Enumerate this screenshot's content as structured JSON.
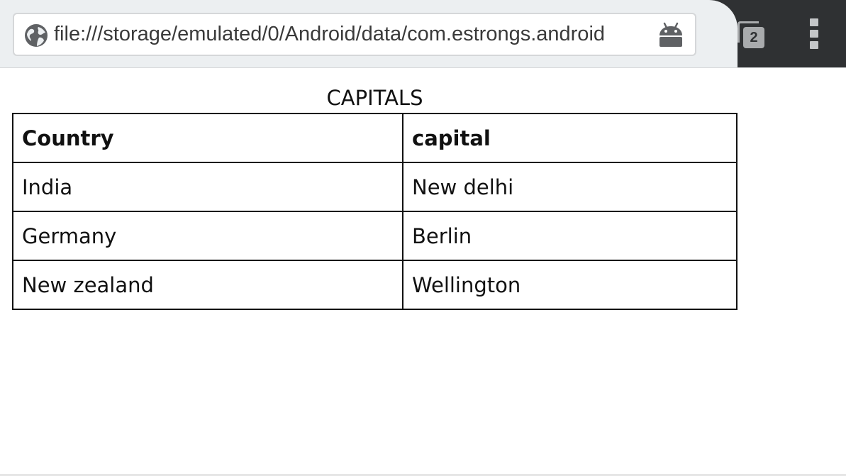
{
  "browser": {
    "url": "file:///storage/emulated/0/Android/data/com.estrongs.android",
    "tab_count": "2",
    "icons": {
      "site": "globe-icon",
      "page_action": "android-icon",
      "tabs": "tab-switcher-icon",
      "menu": "overflow-menu-icon"
    },
    "colors": {
      "toolbar_light": "#eceff1",
      "toolbar_dark": "#2f3133"
    }
  },
  "page": {
    "caption": "CAPITALS",
    "table": {
      "headers": [
        "Country",
        "capital"
      ],
      "rows": [
        [
          "India",
          "New delhi"
        ],
        [
          "Germany",
          "Berlin"
        ],
        [
          "New zealand",
          "Wellington"
        ]
      ]
    }
  }
}
